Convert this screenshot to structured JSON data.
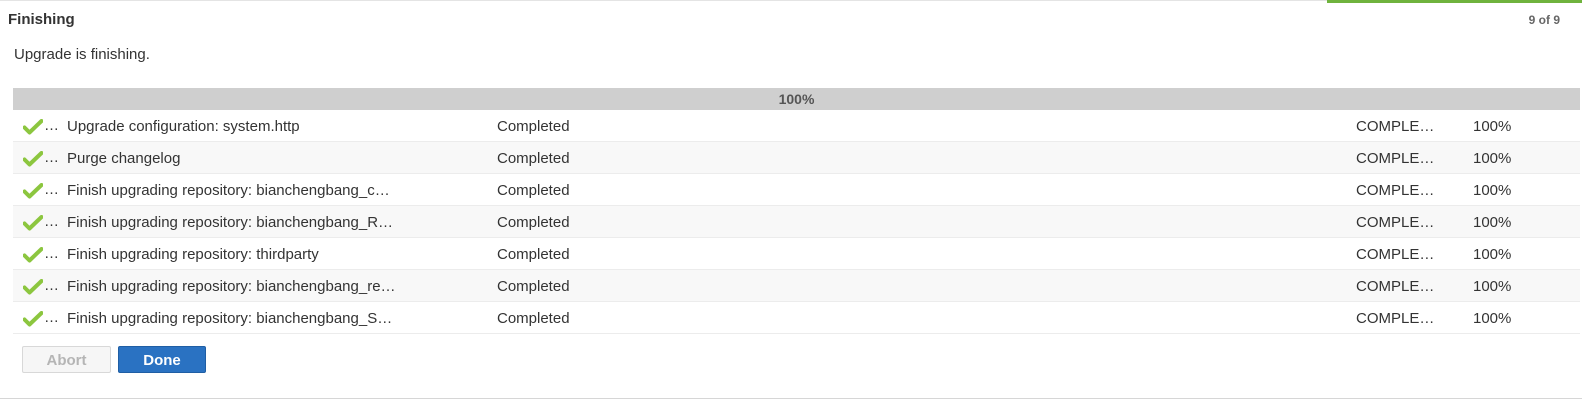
{
  "header": {
    "title": "Finishing",
    "step_count": "9 of 9"
  },
  "message": "Upgrade is finishing.",
  "progress": {
    "label": "100%",
    "percent": 100
  },
  "colors": {
    "accent_green": "#6fb33d",
    "check_green": "#8cc63f",
    "done_blue": "#2a72c2",
    "progress_gray": "#cfcfcf"
  },
  "tasks": [
    {
      "icon": "checkmark-icon",
      "icon_ellipsis": "…",
      "name": "Upgrade configuration: system.http",
      "status": "Completed",
      "state": "COMPLE…",
      "percent": "100%"
    },
    {
      "icon": "checkmark-icon",
      "icon_ellipsis": "…",
      "name": "Purge changelog",
      "status": "Completed",
      "state": "COMPLE…",
      "percent": "100%"
    },
    {
      "icon": "checkmark-icon",
      "icon_ellipsis": "…",
      "name": "Finish upgrading repository: bianchengbang_c…",
      "status": "Completed",
      "state": "COMPLE…",
      "percent": "100%"
    },
    {
      "icon": "checkmark-icon",
      "icon_ellipsis": "…",
      "name": "Finish upgrading repository: bianchengbang_R…",
      "status": "Completed",
      "state": "COMPLE…",
      "percent": "100%"
    },
    {
      "icon": "checkmark-icon",
      "icon_ellipsis": "…",
      "name": "Finish upgrading repository: thirdparty",
      "status": "Completed",
      "state": "COMPLE…",
      "percent": "100%"
    },
    {
      "icon": "checkmark-icon",
      "icon_ellipsis": "…",
      "name": "Finish upgrading repository: bianchengbang_re…",
      "status": "Completed",
      "state": "COMPLE…",
      "percent": "100%"
    },
    {
      "icon": "checkmark-icon",
      "icon_ellipsis": "…",
      "name": "Finish upgrading repository: bianchengbang_S…",
      "status": "Completed",
      "state": "COMPLE…",
      "percent": "100%"
    }
  ],
  "buttons": {
    "abort_label": "Abort",
    "done_label": "Done"
  }
}
